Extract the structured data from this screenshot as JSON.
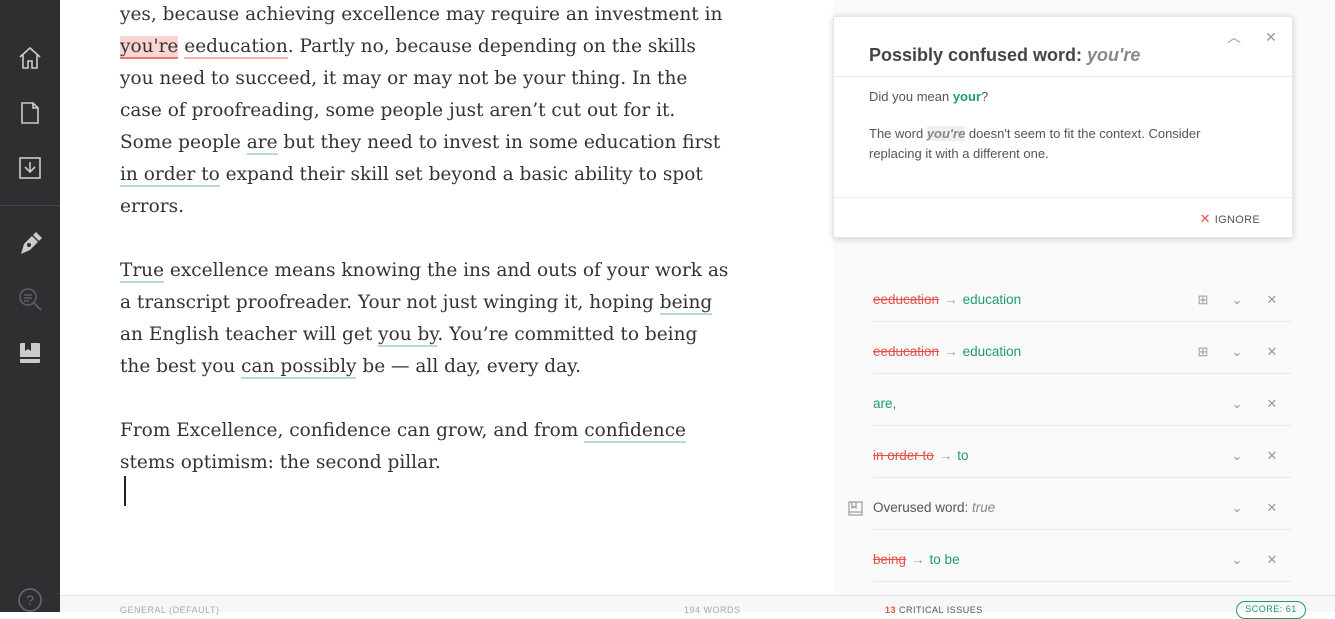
{
  "sidebar": {
    "items": [
      {
        "name": "home-icon"
      },
      {
        "name": "document-icon"
      },
      {
        "name": "download-icon"
      },
      {
        "name": "pen-icon"
      },
      {
        "name": "search-icon"
      },
      {
        "name": "book-icon"
      },
      {
        "name": "help-icon",
        "label": "?"
      }
    ]
  },
  "editor": {
    "p1": {
      "l1": "yes, because achieving excellence may require an investment in",
      "youre": "you're",
      "eeducation": "eeducation",
      "l2": ". Partly no, because depending on the skills you need to succeed, it may or may not be your thing. In the case of proofreading, some people just aren’t cut out for it. Some people ",
      "are": "are",
      "l3": " but they need to invest in some education first ",
      "inorderto": "in order to",
      "l4": " expand their skill set beyond a basic ability to spot errors."
    },
    "p2": {
      "true": "True",
      "l1": " excellence means knowing the ins and outs of your work as a transcript proofreader. Your not just winging it, hoping ",
      "being": "being",
      "l2": " an English teacher will get ",
      "youby": "you by",
      "l3": ". You’re committed to being the best you ",
      "canpossibly": "can possibly",
      "l4": " be — all day, every day."
    },
    "p3": {
      "l1": "From Excellence, confidence can grow, and from ",
      "confidence": "confidence",
      "l2": " stems optimism: the second pillar."
    }
  },
  "card": {
    "title_prefix": "Possibly confused word: ",
    "title_word": "you're",
    "ask_prefix": "Did you mean ",
    "ask_word": "your",
    "ask_suffix": "?",
    "desc_prefix": "The word ",
    "desc_word": "you're",
    "desc_suffix": " doesn't seem to fit the context. Consider replacing it with a different one.",
    "ignore_label": "IGNORE"
  },
  "alerts": [
    {
      "strike": "eeducation",
      "arrow": "→",
      "fix": "education"
    },
    {
      "strike": "eeducation",
      "arrow": "→",
      "fix": "education"
    },
    {
      "fix": "are,"
    },
    {
      "strike": "in order to",
      "arrow": "→",
      "fix": "to"
    },
    {
      "label": "Overused word: ",
      "label_em": "true"
    },
    {
      "strike": "being",
      "arrow": "→",
      "fix": "to be"
    }
  ],
  "footer": {
    "mode": "GENERAL (DEFAULT)",
    "words": "194 WORDS",
    "issues_count": "13",
    "issues_label": " CRITICAL ISSUES",
    "score": "SCORE: 61"
  },
  "colors": {
    "sidebar_bg": "#2d2f31",
    "accent_green": "#1f9c6b",
    "error_red": "#e0524a"
  }
}
